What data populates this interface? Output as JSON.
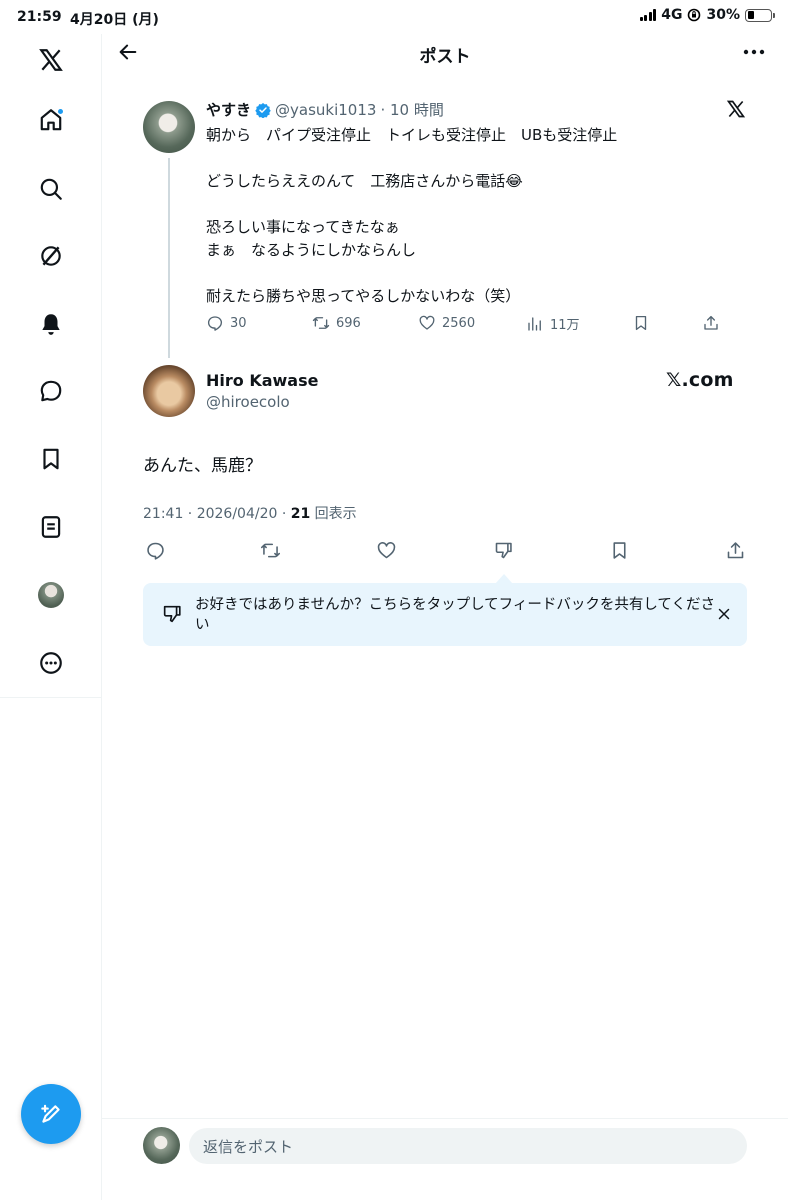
{
  "status_bar": {
    "time": "21:59",
    "date": "4月20日 (月)",
    "network": "4G",
    "battery": "30%"
  },
  "header": {
    "title": "ポスト"
  },
  "quoted_post": {
    "display_name": "やすき",
    "handle": "@yasuki1013",
    "time_ago": "· 10 時間",
    "lines": [
      "朝から　パイプ受注停止　トイレも受注停止　UBも受注停止",
      "",
      "どうしたらええのんて　工務店さんから電話😂",
      "",
      "恐ろしい事になってきたなぁ",
      "まぁ　なるようにしかならんし",
      "",
      "耐えたら勝ちや思ってやるしかないわな（笑）"
    ],
    "replies": "30",
    "reposts": "696",
    "likes": "2560",
    "views": "11万"
  },
  "main_post": {
    "display_name": "Hiro Kawase",
    "handle": "@hiroecolo",
    "source_label": "𝕏.com",
    "text": "あんた、馬鹿？",
    "timestamp": "21:41 · 2026/04/20 · ",
    "view_count": "21",
    "view_label": " 回表示"
  },
  "feedback": {
    "text": "お好きではありませんか？こちらをタップしてフィードバックを共有してください"
  },
  "reply": {
    "placeholder": "返信をポスト"
  },
  "colors": {
    "accent": "#1d9bf0",
    "text": "#0f1419",
    "muted": "#536471",
    "feedback_bg": "#e8f5fd"
  }
}
